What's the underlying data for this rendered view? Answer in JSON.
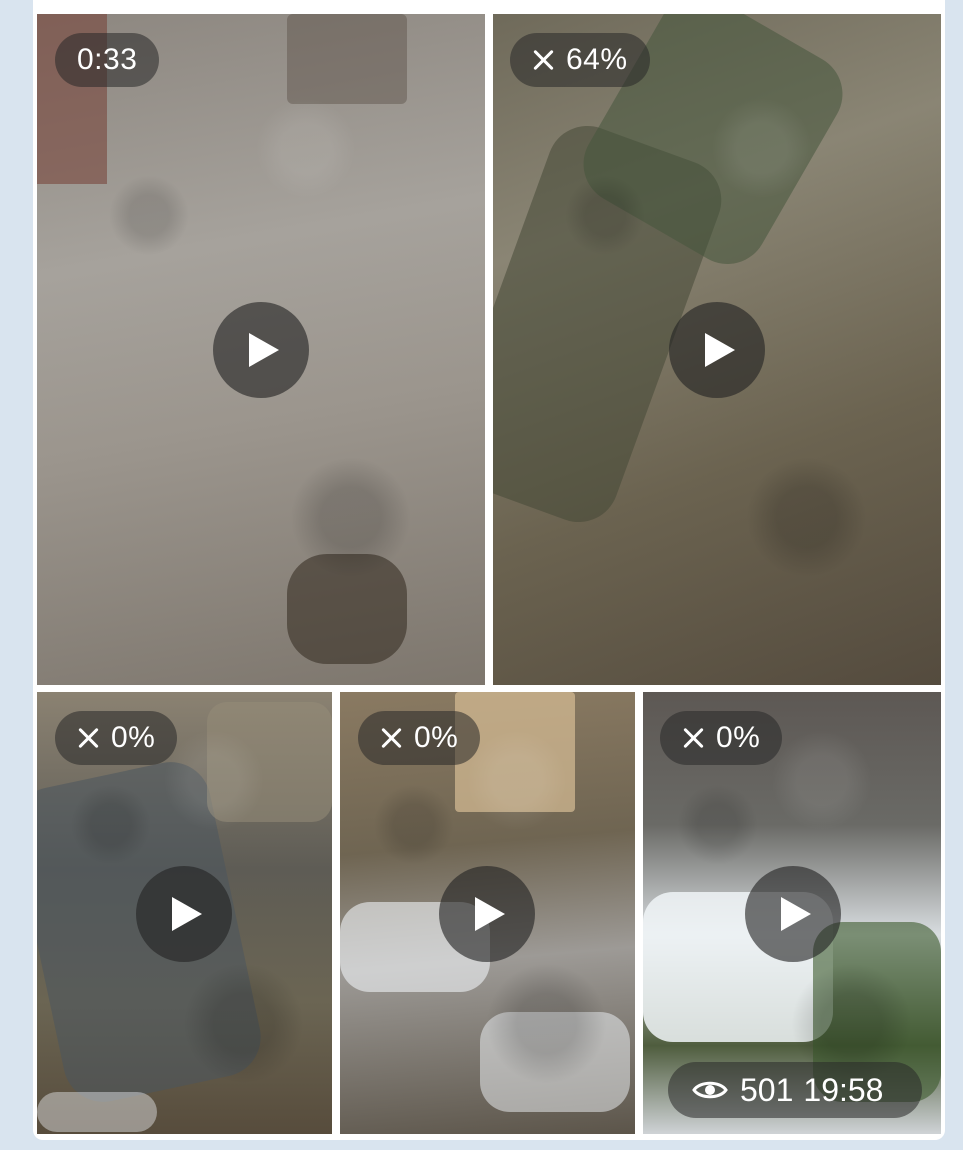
{
  "message": {
    "media": [
      {
        "badge_type": "duration",
        "badge_text": "0:33"
      },
      {
        "badge_type": "download",
        "badge_text": "64%"
      },
      {
        "badge_type": "download",
        "badge_text": "0%"
      },
      {
        "badge_type": "download",
        "badge_text": "0%"
      },
      {
        "badge_type": "download",
        "badge_text": "0%"
      }
    ],
    "views": "501",
    "time": "19:58"
  },
  "icons": {
    "play": "play-icon",
    "cancel": "close-icon",
    "views": "eye-icon"
  },
  "colors": {
    "overlay": "#282828",
    "overlay_text": "#ffffff",
    "chat_background": "#d9e4ef",
    "bubble": "#ffffff"
  }
}
